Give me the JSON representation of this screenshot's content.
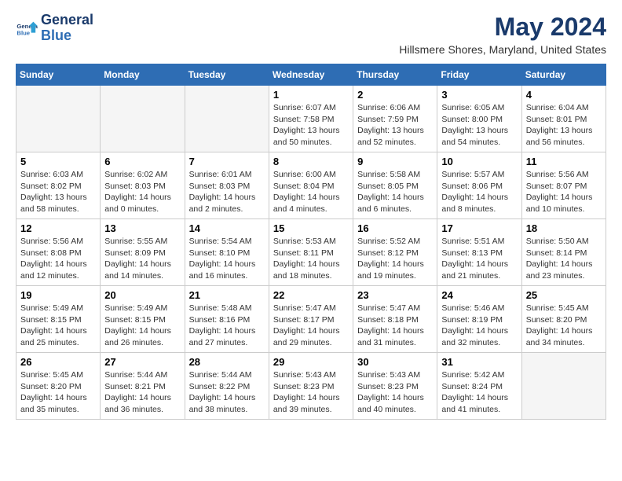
{
  "logo": {
    "line1": "General",
    "line2": "Blue"
  },
  "title": "May 2024",
  "subtitle": "Hillsmere Shores, Maryland, United States",
  "weekdays": [
    "Sunday",
    "Monday",
    "Tuesday",
    "Wednesday",
    "Thursday",
    "Friday",
    "Saturday"
  ],
  "weeks": [
    [
      {
        "day": "",
        "info": ""
      },
      {
        "day": "",
        "info": ""
      },
      {
        "day": "",
        "info": ""
      },
      {
        "day": "1",
        "info": "Sunrise: 6:07 AM\nSunset: 7:58 PM\nDaylight: 13 hours and 50 minutes."
      },
      {
        "day": "2",
        "info": "Sunrise: 6:06 AM\nSunset: 7:59 PM\nDaylight: 13 hours and 52 minutes."
      },
      {
        "day": "3",
        "info": "Sunrise: 6:05 AM\nSunset: 8:00 PM\nDaylight: 13 hours and 54 minutes."
      },
      {
        "day": "4",
        "info": "Sunrise: 6:04 AM\nSunset: 8:01 PM\nDaylight: 13 hours and 56 minutes."
      }
    ],
    [
      {
        "day": "5",
        "info": "Sunrise: 6:03 AM\nSunset: 8:02 PM\nDaylight: 13 hours and 58 minutes."
      },
      {
        "day": "6",
        "info": "Sunrise: 6:02 AM\nSunset: 8:03 PM\nDaylight: 14 hours and 0 minutes."
      },
      {
        "day": "7",
        "info": "Sunrise: 6:01 AM\nSunset: 8:03 PM\nDaylight: 14 hours and 2 minutes."
      },
      {
        "day": "8",
        "info": "Sunrise: 6:00 AM\nSunset: 8:04 PM\nDaylight: 14 hours and 4 minutes."
      },
      {
        "day": "9",
        "info": "Sunrise: 5:58 AM\nSunset: 8:05 PM\nDaylight: 14 hours and 6 minutes."
      },
      {
        "day": "10",
        "info": "Sunrise: 5:57 AM\nSunset: 8:06 PM\nDaylight: 14 hours and 8 minutes."
      },
      {
        "day": "11",
        "info": "Sunrise: 5:56 AM\nSunset: 8:07 PM\nDaylight: 14 hours and 10 minutes."
      }
    ],
    [
      {
        "day": "12",
        "info": "Sunrise: 5:56 AM\nSunset: 8:08 PM\nDaylight: 14 hours and 12 minutes."
      },
      {
        "day": "13",
        "info": "Sunrise: 5:55 AM\nSunset: 8:09 PM\nDaylight: 14 hours and 14 minutes."
      },
      {
        "day": "14",
        "info": "Sunrise: 5:54 AM\nSunset: 8:10 PM\nDaylight: 14 hours and 16 minutes."
      },
      {
        "day": "15",
        "info": "Sunrise: 5:53 AM\nSunset: 8:11 PM\nDaylight: 14 hours and 18 minutes."
      },
      {
        "day": "16",
        "info": "Sunrise: 5:52 AM\nSunset: 8:12 PM\nDaylight: 14 hours and 19 minutes."
      },
      {
        "day": "17",
        "info": "Sunrise: 5:51 AM\nSunset: 8:13 PM\nDaylight: 14 hours and 21 minutes."
      },
      {
        "day": "18",
        "info": "Sunrise: 5:50 AM\nSunset: 8:14 PM\nDaylight: 14 hours and 23 minutes."
      }
    ],
    [
      {
        "day": "19",
        "info": "Sunrise: 5:49 AM\nSunset: 8:15 PM\nDaylight: 14 hours and 25 minutes."
      },
      {
        "day": "20",
        "info": "Sunrise: 5:49 AM\nSunset: 8:15 PM\nDaylight: 14 hours and 26 minutes."
      },
      {
        "day": "21",
        "info": "Sunrise: 5:48 AM\nSunset: 8:16 PM\nDaylight: 14 hours and 27 minutes."
      },
      {
        "day": "22",
        "info": "Sunrise: 5:47 AM\nSunset: 8:17 PM\nDaylight: 14 hours and 29 minutes."
      },
      {
        "day": "23",
        "info": "Sunrise: 5:47 AM\nSunset: 8:18 PM\nDaylight: 14 hours and 31 minutes."
      },
      {
        "day": "24",
        "info": "Sunrise: 5:46 AM\nSunset: 8:19 PM\nDaylight: 14 hours and 32 minutes."
      },
      {
        "day": "25",
        "info": "Sunrise: 5:45 AM\nSunset: 8:20 PM\nDaylight: 14 hours and 34 minutes."
      }
    ],
    [
      {
        "day": "26",
        "info": "Sunrise: 5:45 AM\nSunset: 8:20 PM\nDaylight: 14 hours and 35 minutes."
      },
      {
        "day": "27",
        "info": "Sunrise: 5:44 AM\nSunset: 8:21 PM\nDaylight: 14 hours and 36 minutes."
      },
      {
        "day": "28",
        "info": "Sunrise: 5:44 AM\nSunset: 8:22 PM\nDaylight: 14 hours and 38 minutes."
      },
      {
        "day": "29",
        "info": "Sunrise: 5:43 AM\nSunset: 8:23 PM\nDaylight: 14 hours and 39 minutes."
      },
      {
        "day": "30",
        "info": "Sunrise: 5:43 AM\nSunset: 8:23 PM\nDaylight: 14 hours and 40 minutes."
      },
      {
        "day": "31",
        "info": "Sunrise: 5:42 AM\nSunset: 8:24 PM\nDaylight: 14 hours and 41 minutes."
      },
      {
        "day": "",
        "info": ""
      }
    ]
  ]
}
